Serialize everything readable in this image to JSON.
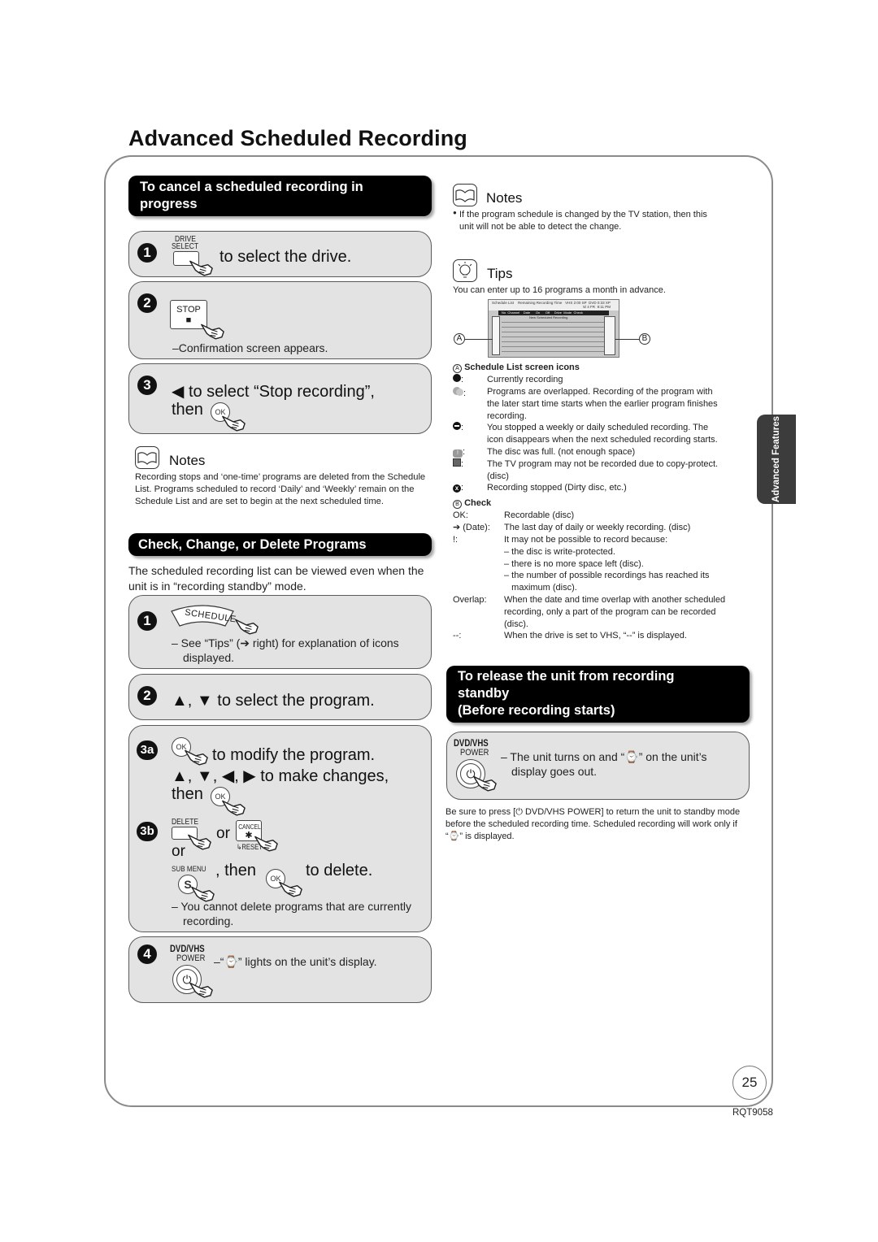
{
  "page": {
    "title": "Advanced Scheduled Recording",
    "side_tab": "Advanced Features",
    "page_number": "25",
    "doc_code": "RQT9058"
  },
  "cancel_section": {
    "header": "To cancel a scheduled recording in progress",
    "step1": {
      "number": "1",
      "button_label_top": "DRIVE",
      "button_label_bottom": "SELECT",
      "text": "to select the drive."
    },
    "step2": {
      "number": "2",
      "button_label": "STOP",
      "button_glyph": "■",
      "note": "–Confirmation screen appears."
    },
    "step3": {
      "number": "3",
      "line1": "◀ to select “Stop recording”,",
      "line2": "then",
      "ok_label": "OK"
    },
    "notes": {
      "title": "Notes",
      "text": "Recording stops and ‘one-time’ programs are deleted from the Schedule List.  Programs scheduled to record ‘Daily’ and ‘Weekly’ remain on the Schedule List and are set to begin at the next scheduled time."
    }
  },
  "check_section": {
    "header": "Check, Change, or Delete Programs",
    "intro": "The scheduled recording list can be viewed even when the unit is in “recording standby” mode.",
    "step1": {
      "number": "1",
      "button_label": "SCHEDULE",
      "note_line1": "– See “Tips” (➔ right) for explanation of icons",
      "note_line2": "displayed."
    },
    "step2": {
      "number": "2",
      "text": "▲, ▼ to select the program."
    },
    "step3a": {
      "number": "3a",
      "ok_label": "OK",
      "line1": "to modify the program.",
      "line2": "▲, ▼, ◀, ▶ to make changes,",
      "line3": "then"
    },
    "step3b": {
      "number": "3b",
      "delete_label": "DELETE",
      "or1": "or",
      "cancel_label": "CANCEL",
      "cancel_glyph": "✱",
      "reset_label": "↳RESET",
      "or2": "or",
      "submenu_label": "SUB MENU",
      "submenu_glyph": "S",
      "then": ", then",
      "ok_label": "OK",
      "to_delete": "to delete.",
      "note_line1": "– You cannot delete programs that are currently",
      "note_line2": "recording."
    },
    "step4": {
      "number": "4",
      "brand": "DVD/VHS",
      "power_label": "POWER",
      "power_glyph": "⏻",
      "note": "–“⌚” lights on the unit’s display."
    }
  },
  "right_notes": {
    "title": "Notes",
    "bullet": "●",
    "line1": "If the program schedule is changed by the TV station, then this",
    "line2": "unit will not be able to detect the change."
  },
  "tips": {
    "title": "Tips",
    "text": "You can enter up to 16 programs a month in advance.",
    "screen": {
      "title": "Schedule List",
      "remaining": "Remaining Recording Time",
      "vhs": "VHS  2:00 SP",
      "dvd": "DVD  0:33 XP",
      "date": "5/ 4 FR",
      "time": "9:11 PM",
      "columns": [
        "No",
        "Channel",
        "Date",
        "On",
        "Off",
        "Drive",
        "Mode",
        "Check"
      ],
      "new_row": "New Scheduled Recording",
      "callout_a": "A",
      "callout_b": "B"
    }
  },
  "icons_legend": {
    "marker": "A",
    "title": "Schedule List screen icons",
    "items": [
      {
        "icon": "recording-dot-icon",
        "key": "●:",
        "lines": [
          "Currently recording"
        ]
      },
      {
        "icon": "overlap-icon",
        "key": ":",
        "lines": [
          "Programs are overlapped. Recording of the program with",
          "the later start time starts when the earlier program finishes",
          "recording."
        ]
      },
      {
        "icon": "stopped-icon",
        "key": ":",
        "lines": [
          "You stopped a weekly or daily scheduled recording. The",
          "icon disappears when the next scheduled recording starts."
        ]
      },
      {
        "icon": "disc-full-icon",
        "key": ":",
        "lines": [
          "The disc was full. (not enough space)"
        ]
      },
      {
        "icon": "copy-protect-icon",
        "key": ":",
        "lines": [
          "The TV program may not be recorded due to copy-protect.",
          "(disc)"
        ]
      },
      {
        "icon": "error-x-icon",
        "key": ":",
        "lines": [
          "Recording stopped (Dirty disc, etc.)"
        ]
      }
    ]
  },
  "check_legend": {
    "marker": "B",
    "title": "Check",
    "items": [
      {
        "key": "OK:",
        "lines": [
          "Recordable (disc)"
        ]
      },
      {
        "key": "➔ (Date):",
        "lines": [
          "The last day of daily or weekly recording. (disc)"
        ]
      },
      {
        "key": "!:",
        "lines": [
          "It may not be possible to record because:",
          "– the disc is write-protected.",
          "– there is no more space left (disc).",
          "– the number of possible recordings has reached its",
          "   maximum (disc)."
        ]
      },
      {
        "key": "Overlap:",
        "lines": [
          "When the date and time overlap with another scheduled",
          "recording, only a part of the program can be recorded",
          "(disc)."
        ]
      },
      {
        "key": "--:",
        "lines": [
          "When the drive is set to VHS, “--” is displayed."
        ]
      }
    ]
  },
  "release_section": {
    "header_line1": "To release the unit from recording",
    "header_line2": "standby",
    "header_line3": "(Before recording starts)",
    "brand": "DVD/VHS",
    "power_label": "POWER",
    "power_glyph": "⏻",
    "note_line1": "– The unit turns on and “⌚” on the unit’s",
    "note_line2": "display goes out.",
    "footer": "Be sure to press [⏻ DVD/VHS POWER] to return the unit to standby mode before the scheduled recording time. Scheduled recording will work only if “⌚” is displayed."
  }
}
